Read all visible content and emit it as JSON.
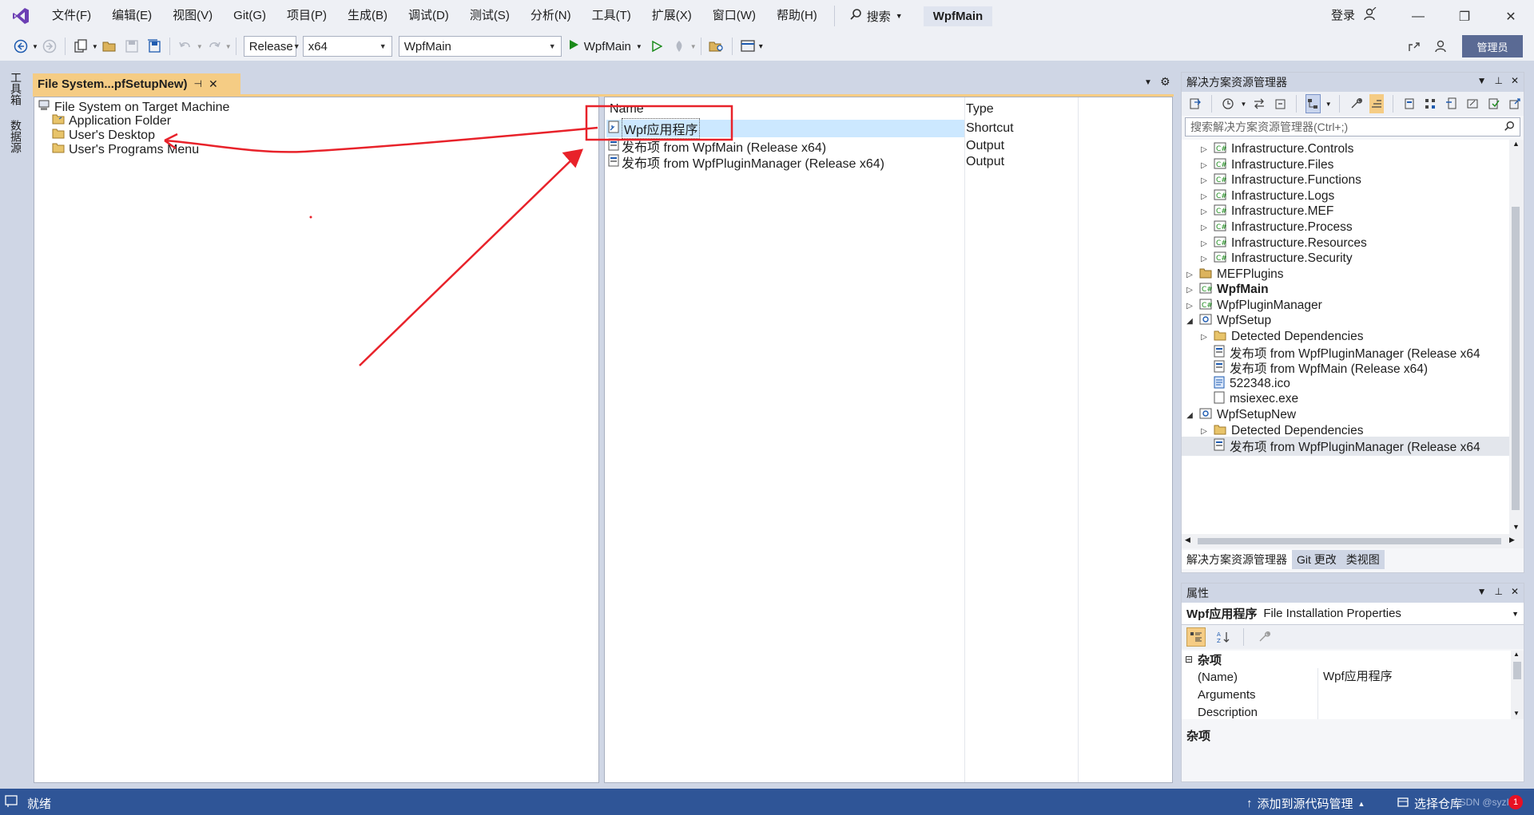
{
  "menubar": {
    "items": [
      "文件(F)",
      "编辑(E)",
      "视图(V)",
      "Git(G)",
      "项目(P)",
      "生成(B)",
      "调试(D)",
      "测试(S)",
      "分析(N)",
      "工具(T)",
      "扩展(X)",
      "窗口(W)",
      "帮助(H)"
    ],
    "search_label": "搜索",
    "solution_title": "WpfMain",
    "login_label": "登录"
  },
  "toolbar": {
    "config_value": "Release",
    "platform_value": "x64",
    "project_value": "WpfMain",
    "start_label": "WpfMain",
    "admin_label": "管理员"
  },
  "left_strip": {
    "tab1": "工具箱",
    "tab2": "数据源"
  },
  "doc_tab": {
    "title": "File System...pfSetupNew)"
  },
  "tree": {
    "root": "File System on Target Machine",
    "items": [
      "Application Folder",
      "User's Desktop",
      "User's Programs Menu"
    ]
  },
  "list": {
    "col_name": "Name",
    "col_type": "Type",
    "rows": [
      {
        "name": "Wpf应用程序",
        "type": "Shortcut"
      },
      {
        "name": "发布项 from WpfMain (Release x64)",
        "type": "Output"
      },
      {
        "name": "发布项 from WpfPluginManager (Release x64)",
        "type": "Output"
      }
    ]
  },
  "solution_explorer": {
    "title": "解决方案资源管理器",
    "search_placeholder": "搜索解决方案资源管理器(Ctrl+;)",
    "rows": [
      {
        "label": "Infrastructure.Controls"
      },
      {
        "label": "Infrastructure.Files"
      },
      {
        "label": "Infrastructure.Functions"
      },
      {
        "label": "Infrastructure.Logs"
      },
      {
        "label": "Infrastructure.MEF"
      },
      {
        "label": "Infrastructure.Process"
      },
      {
        "label": "Infrastructure.Resources"
      },
      {
        "label": "Infrastructure.Security"
      },
      {
        "label": "MEFPlugins"
      },
      {
        "label": "WpfMain"
      },
      {
        "label": "WpfPluginManager"
      },
      {
        "label": "WpfSetup"
      },
      {
        "label": "Detected Dependencies"
      },
      {
        "label": "发布项 from WpfPluginManager (Release x64"
      },
      {
        "label": "发布项 from WpfMain (Release x64)"
      },
      {
        "label": "522348.ico"
      },
      {
        "label": "msiexec.exe"
      },
      {
        "label": "WpfSetupNew"
      },
      {
        "label": "Detected Dependencies"
      },
      {
        "label": "发布项 from WpfPluginManager (Release x64"
      }
    ],
    "bottom_tabs": [
      "解决方案资源管理器",
      "Git 更改",
      "类视图"
    ]
  },
  "properties": {
    "title": "属性",
    "object_name": "Wpf应用程序",
    "object_type": "File Installation Properties",
    "category": "杂项",
    "rows": [
      {
        "key": "(Name)",
        "value": "Wpf应用程序"
      },
      {
        "key": "Arguments",
        "value": ""
      },
      {
        "key": "Description",
        "value": ""
      }
    ],
    "description_title": "杂项"
  },
  "statusbar": {
    "ready": "就绪",
    "add_source": "添加到源代码管理",
    "select_repo": "选择仓库",
    "watermark": "CSDN @syzIx",
    "bell_count": "1"
  },
  "colors": {
    "accent": "#2f5597",
    "doc_tab": "#f5cc84",
    "selection": "#cce8ff",
    "annotation": "#e8222a"
  }
}
